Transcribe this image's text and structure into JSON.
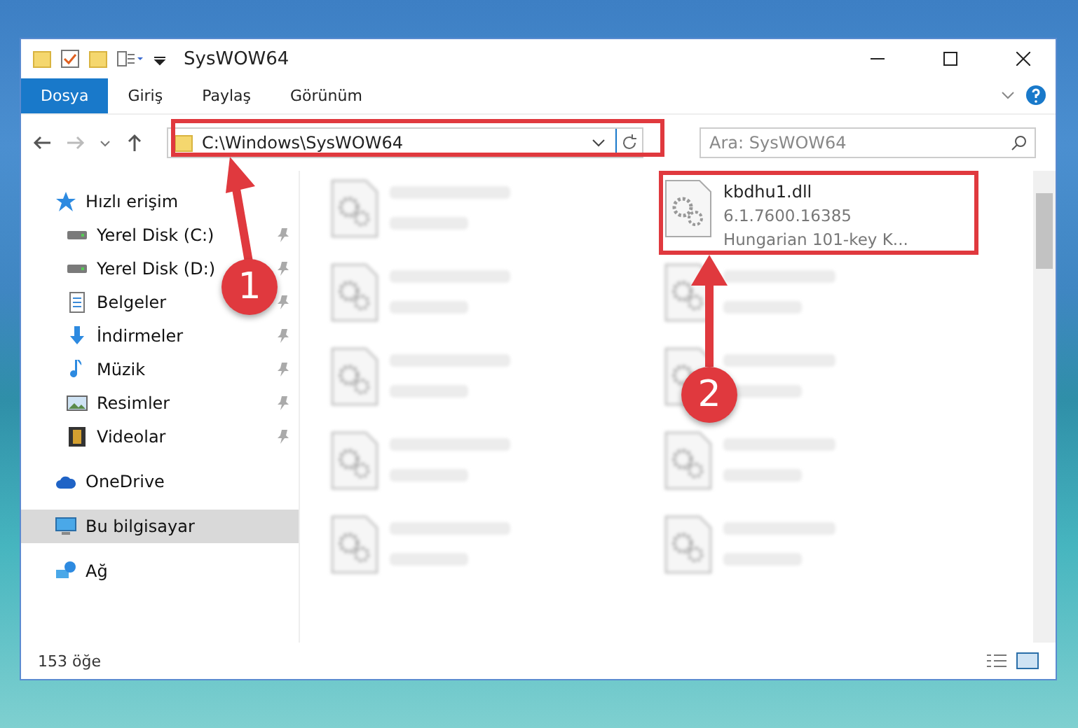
{
  "window": {
    "title": "SysWOW64"
  },
  "tabs": [
    {
      "label": "Dosya",
      "selected": true
    },
    {
      "label": "Giriş",
      "selected": false
    },
    {
      "label": "Paylaş",
      "selected": false
    },
    {
      "label": "Görünüm",
      "selected": false
    }
  ],
  "address": {
    "path": "C:\\Windows\\SysWOW64"
  },
  "search": {
    "placeholder": "Ara: SysWOW64"
  },
  "sidebar": {
    "items": [
      {
        "label": "Hızlı erişim",
        "kind": "star",
        "selected": false,
        "children": [
          {
            "label": "Yerel Disk (C:)",
            "kind": "drive",
            "selected": false,
            "pinned": true
          },
          {
            "label": "Yerel Disk (D:)",
            "kind": "drive",
            "selected": false,
            "pinned": true
          },
          {
            "label": "Belgeler",
            "kind": "documents",
            "selected": false,
            "pinned": true
          },
          {
            "label": "İndirmeler",
            "kind": "download",
            "selected": false,
            "pinned": true
          },
          {
            "label": "Müzik",
            "kind": "music",
            "selected": false,
            "pinned": true
          },
          {
            "label": "Resimler",
            "kind": "pictures",
            "selected": false,
            "pinned": true
          },
          {
            "label": "Videolar",
            "kind": "videos",
            "selected": false,
            "pinned": true
          }
        ]
      },
      {
        "label": "OneDrive",
        "kind": "cloud",
        "selected": false
      },
      {
        "label": "Bu bilgisayar",
        "kind": "computer",
        "selected": true
      },
      {
        "label": "Ağ",
        "kind": "network",
        "selected": false
      }
    ]
  },
  "files": [
    {
      "blurred": true
    },
    {
      "name": "kbdhu1.dll",
      "lines": [
        "6.1.7600.16385",
        "Hungarian 101-key K..."
      ],
      "blurred": false
    },
    {
      "blurred": true
    },
    {
      "blurred": true
    },
    {
      "blurred": true
    },
    {
      "blurred": true
    },
    {
      "blurred": true
    },
    {
      "blurred": true
    },
    {
      "blurred": true
    },
    {
      "blurred": true
    }
  ],
  "status_bar": {
    "count": "153 öğe"
  },
  "annotations": [
    {
      "number": "1"
    },
    {
      "number": "2"
    }
  ]
}
